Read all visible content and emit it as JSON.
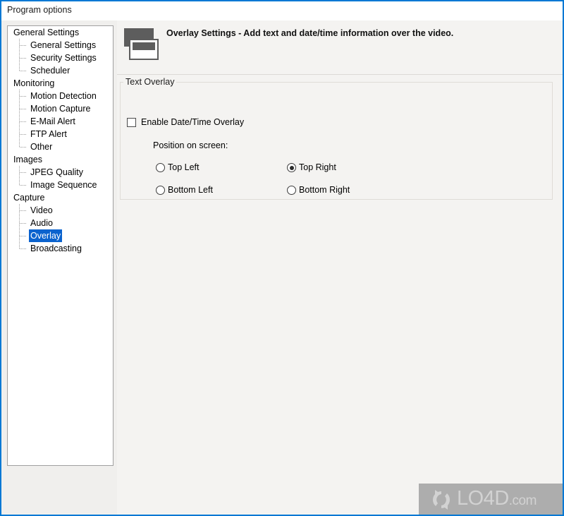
{
  "window": {
    "title": "Program options",
    "accent_color": "#0078d4",
    "client_background": "#f4f3f1"
  },
  "sidebar": {
    "name": "settings-tree",
    "selection_color": "#0b63ce",
    "items": [
      {
        "label": "General Settings",
        "level": "root",
        "selected": false,
        "last": false
      },
      {
        "label": "General Settings",
        "level": "child",
        "selected": false,
        "last": false
      },
      {
        "label": "Security Settings",
        "level": "child",
        "selected": false,
        "last": false
      },
      {
        "label": "Scheduler",
        "level": "child",
        "selected": false,
        "last": true
      },
      {
        "label": "Monitoring",
        "level": "root",
        "selected": false,
        "last": false
      },
      {
        "label": "Motion Detection",
        "level": "child",
        "selected": false,
        "last": false
      },
      {
        "label": "Motion Capture",
        "level": "child",
        "selected": false,
        "last": false
      },
      {
        "label": "E-Mail Alert",
        "level": "child",
        "selected": false,
        "last": false
      },
      {
        "label": "FTP Alert",
        "level": "child",
        "selected": false,
        "last": false
      },
      {
        "label": "Other",
        "level": "child",
        "selected": false,
        "last": true
      },
      {
        "label": "Images",
        "level": "root",
        "selected": false,
        "last": false
      },
      {
        "label": "JPEG Quality",
        "level": "child",
        "selected": false,
        "last": false
      },
      {
        "label": "Image Sequence",
        "level": "child",
        "selected": false,
        "last": true
      },
      {
        "label": "Capture",
        "level": "root",
        "selected": false,
        "last": false
      },
      {
        "label": "Video",
        "level": "child",
        "selected": false,
        "last": false
      },
      {
        "label": "Audio",
        "level": "child",
        "selected": false,
        "last": false
      },
      {
        "label": "Overlay",
        "level": "child",
        "selected": true,
        "last": false
      },
      {
        "label": "Broadcasting",
        "level": "child",
        "selected": false,
        "last": true
      }
    ]
  },
  "header": {
    "title": "Overlay Settings - Add text and date/time information over the video.",
    "icon": "overlay-windows-icon",
    "icon_color": "#5d5d5d"
  },
  "main": {
    "group": {
      "label": "Text Overlay",
      "enable_checkbox": {
        "label": "Enable Date/Time Overlay",
        "checked": false
      },
      "position": {
        "label": "Position on screen:",
        "options": [
          {
            "label": "Top Left",
            "selected": false
          },
          {
            "label": "Bottom Left",
            "selected": false
          },
          {
            "label": "Top Right",
            "selected": true
          },
          {
            "label": "Bottom Right",
            "selected": false
          }
        ]
      }
    }
  },
  "watermark": {
    "text": "LO4D",
    "suffix": ".com",
    "background": "#adadad",
    "text_color": "#d2d2d2"
  }
}
